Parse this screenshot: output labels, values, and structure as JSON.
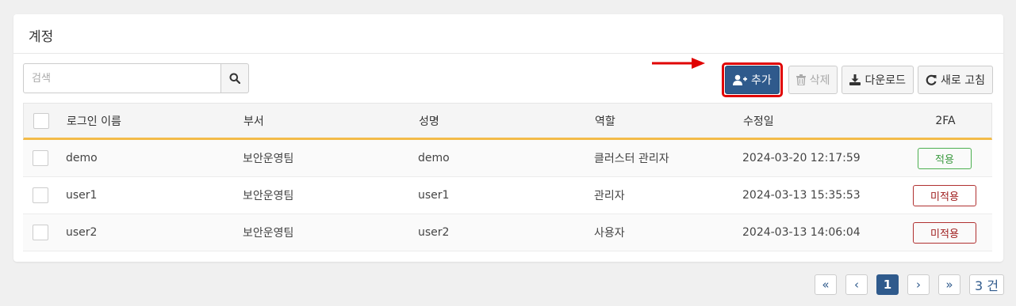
{
  "panel": {
    "title": "계정"
  },
  "search": {
    "placeholder": "검색",
    "value": "",
    "icon": "search-icon"
  },
  "toolbar": {
    "add_label": "추가",
    "delete_label": "삭제",
    "download_label": "다운로드",
    "refresh_label": "새로 고침"
  },
  "colors": {
    "primary": "#2f5a8c",
    "highlight": "#e00000",
    "header_accent": "#f3bb48",
    "badge_on": "#4caf50",
    "badge_off": "#b03030"
  },
  "table": {
    "headers": {
      "login": "로그인 이름",
      "dept": "부서",
      "name": "성명",
      "role": "역할",
      "modified": "수정일",
      "twofa": "2FA"
    },
    "rows": [
      {
        "login": "demo",
        "dept": "보안운영팀",
        "name": "demo",
        "role": "클러스터 관리자",
        "modified": "2024-03-20 12:17:59",
        "twofa": "적용",
        "twofa_on": true
      },
      {
        "login": "user1",
        "dept": "보안운영팀",
        "name": "user1",
        "role": "관리자",
        "modified": "2024-03-13 15:35:53",
        "twofa": "미적용",
        "twofa_on": false
      },
      {
        "login": "user2",
        "dept": "보안운영팀",
        "name": "user2",
        "role": "사용자",
        "modified": "2024-03-13 14:06:04",
        "twofa": "미적용",
        "twofa_on": false
      }
    ]
  },
  "pagination": {
    "first": "«",
    "prev": "‹",
    "current": "1",
    "next": "›",
    "last": "»",
    "total": "3 건"
  }
}
